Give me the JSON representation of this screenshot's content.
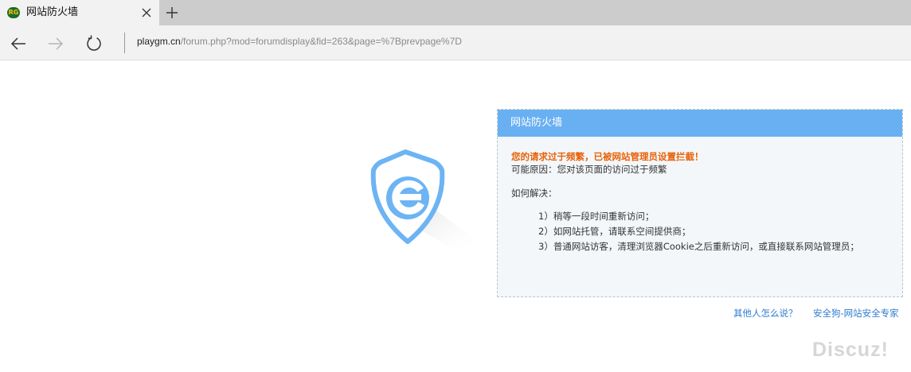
{
  "tab": {
    "favicon_text": "RG",
    "title": "网站防火墙"
  },
  "address": {
    "host": "playgm.cn",
    "path": "/forum.php?mod=forumdisplay&fid=263&page=%7Bprevpage%7D"
  },
  "panel": {
    "title": "网站防火墙",
    "warning": "您的请求过于频繁，已被网站管理员设置拦截！",
    "reason": "可能原因：您对该页面的访问过于频繁",
    "solve_label": "如何解决：",
    "steps": [
      "1）稍等一段时间重新访问；",
      "2）如网站托管，请联系空间提供商；",
      "3）普通网站访客，清理浏览器Cookie之后重新访问，或直接联系网站管理员；"
    ]
  },
  "links": {
    "others": "其他人怎么说？",
    "anquangou": "安全狗-网站安全专家"
  },
  "watermark": "Discuz!",
  "colors": {
    "accent": "#69b0f2",
    "warning": "#e8620a",
    "link": "#2d7bd3"
  }
}
